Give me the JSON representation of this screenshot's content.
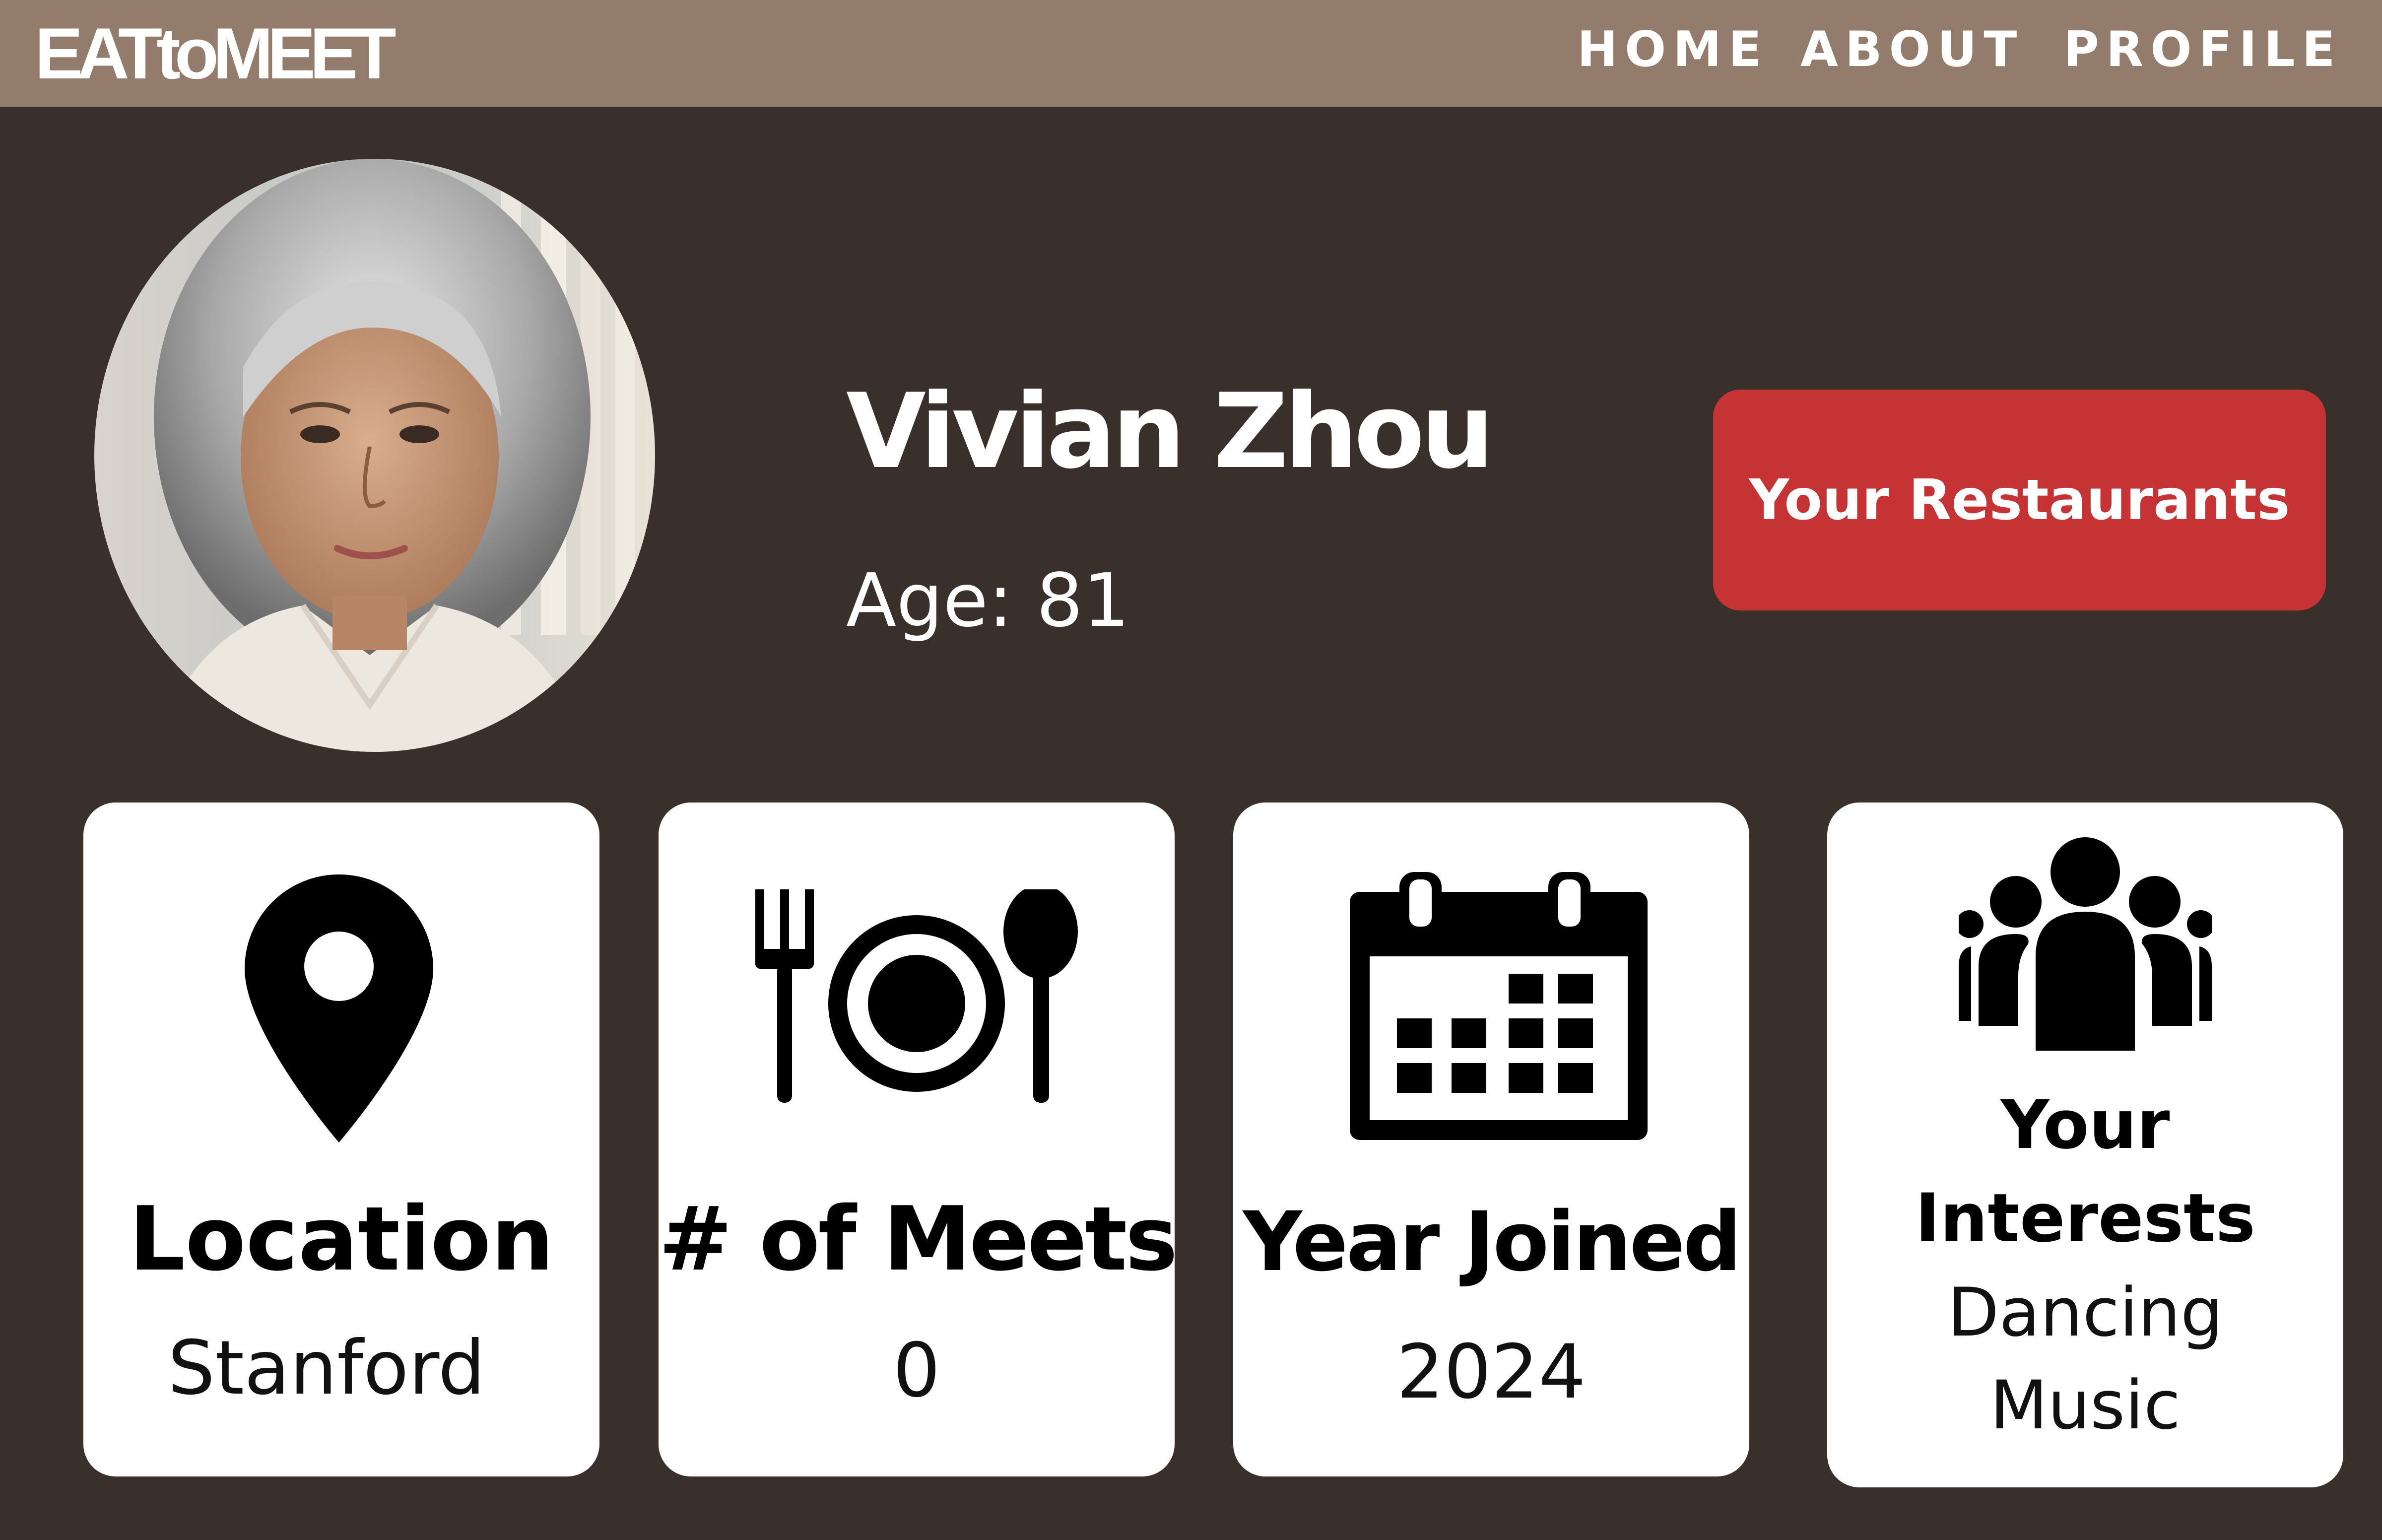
{
  "app": {
    "logo": "EATtoMEET"
  },
  "nav": {
    "items": [
      {
        "label": "HOME"
      },
      {
        "label": "ABOUT"
      },
      {
        "label": "PROFILE"
      }
    ]
  },
  "profile": {
    "name": "Vivian Zhou",
    "age": "Age: 81",
    "restaurants_button": "Your Restaurants"
  },
  "cards": {
    "location": {
      "title": "Location",
      "value": "Stanford",
      "icon": "map-pin-icon"
    },
    "meets": {
      "title": "# of Meets",
      "value": "0",
      "icon": "fork-plate-spoon-icon"
    },
    "year_joined": {
      "title": "Year Joined",
      "value": "2024",
      "icon": "calendar-icon"
    },
    "interests": {
      "title_line1": "Your",
      "title_line2": "Interests",
      "values": [
        "Dancing",
        "Music"
      ],
      "icon": "group-people-icon"
    }
  },
  "colors": {
    "navbar": "#937c6b",
    "background": "#3a302b",
    "button": "#c53334",
    "card": "#ffffff"
  }
}
